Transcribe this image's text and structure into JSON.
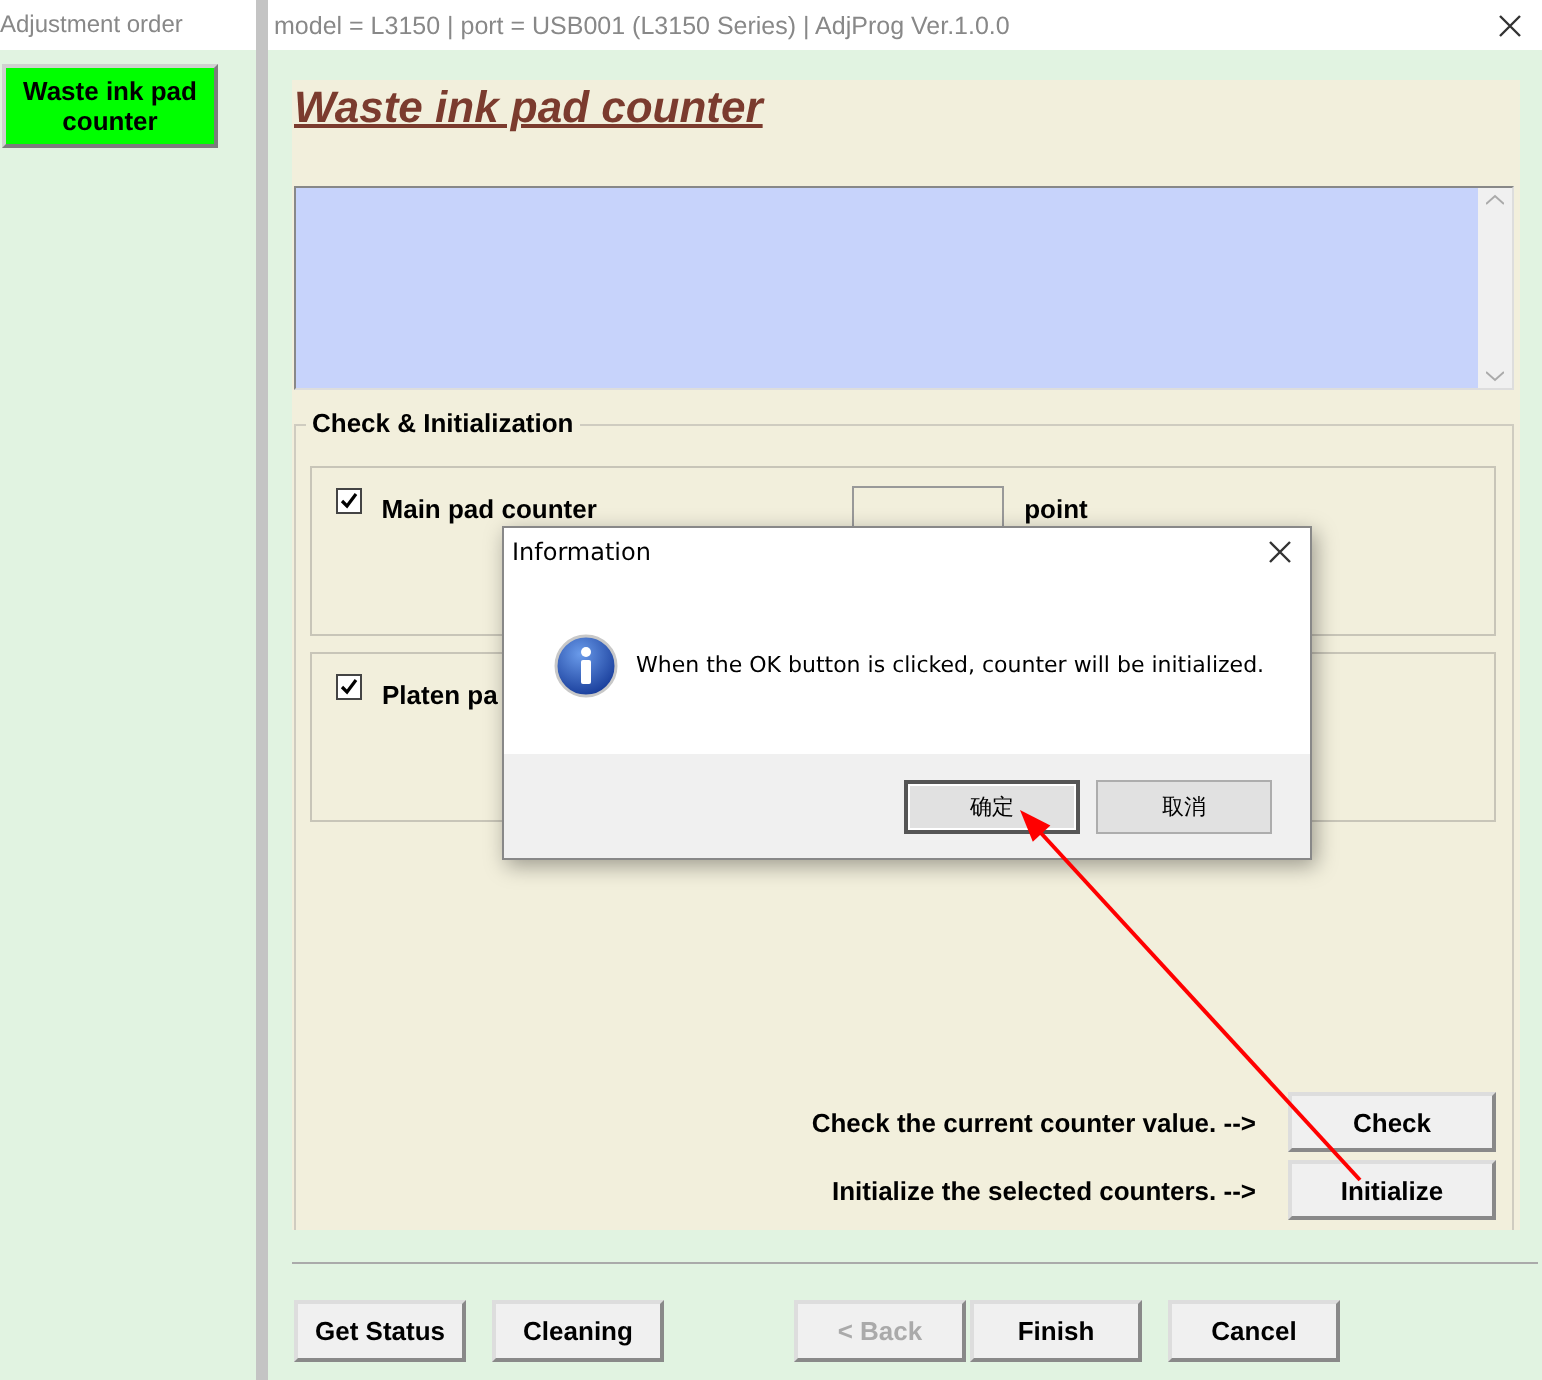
{
  "left_pane": {
    "title": "Adjustment order",
    "items": [
      {
        "label": "Waste ink pad counter",
        "selected": true
      }
    ]
  },
  "window": {
    "title": "model = L3150 | port = USB001 (L3150 Series) | AdjProg Ver.1.0.0"
  },
  "heading": "Waste ink pad counter",
  "group": {
    "title": "Check & Initialization",
    "counters": [
      {
        "label": "Main pad counter",
        "checked": true,
        "unit": "point"
      },
      {
        "label": "Platen pa",
        "checked": true
      }
    ]
  },
  "actions": [
    {
      "text": "Check the current counter value. -->",
      "button": "Check"
    },
    {
      "text": "Initialize the selected counters. -->",
      "button": "Initialize"
    }
  ],
  "footer_left": [
    {
      "label": "Get Status",
      "disabled": false
    },
    {
      "label": "Cleaning",
      "disabled": false
    }
  ],
  "footer_right": [
    {
      "label": "< Back",
      "disabled": true
    },
    {
      "label": "Finish",
      "disabled": false
    },
    {
      "label": "Cancel",
      "disabled": false
    }
  ],
  "dialog": {
    "title": "Information",
    "message": "When the OK button is clicked, counter will be initialized.",
    "buttons": [
      {
        "label": "确定",
        "selected": true
      },
      {
        "label": "取消",
        "selected": false
      }
    ]
  }
}
